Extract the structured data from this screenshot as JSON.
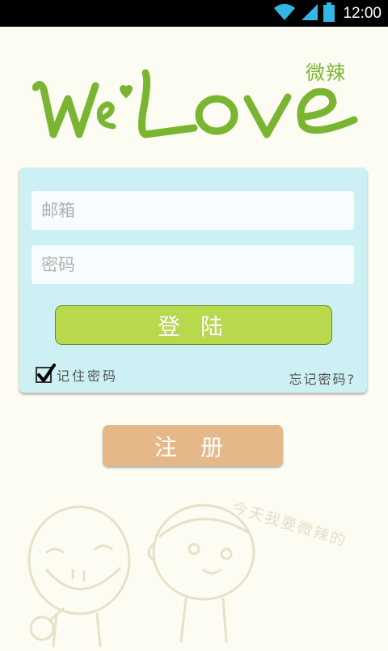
{
  "status_bar": {
    "time": "12:00",
    "icons": [
      "wifi-icon",
      "cell-signal-icon",
      "battery-icon"
    ]
  },
  "logo": {
    "wordmark": "WeLove",
    "subtitle": "微辣",
    "color": "#7ab532"
  },
  "login_form": {
    "email_placeholder": "邮箱",
    "password_placeholder": "密码",
    "login_label": "登 陆",
    "remember_label": "记住密码",
    "remember_checked": true,
    "forgot_label": "忘记密码?"
  },
  "register": {
    "label": "注 册"
  },
  "decoration": {
    "tagline": "今天我要微辣的"
  },
  "colors": {
    "background": "#fdfcf3",
    "card": "#ccf0f4",
    "login_button": "#b8d84e",
    "register_button": "#e5b88a"
  }
}
